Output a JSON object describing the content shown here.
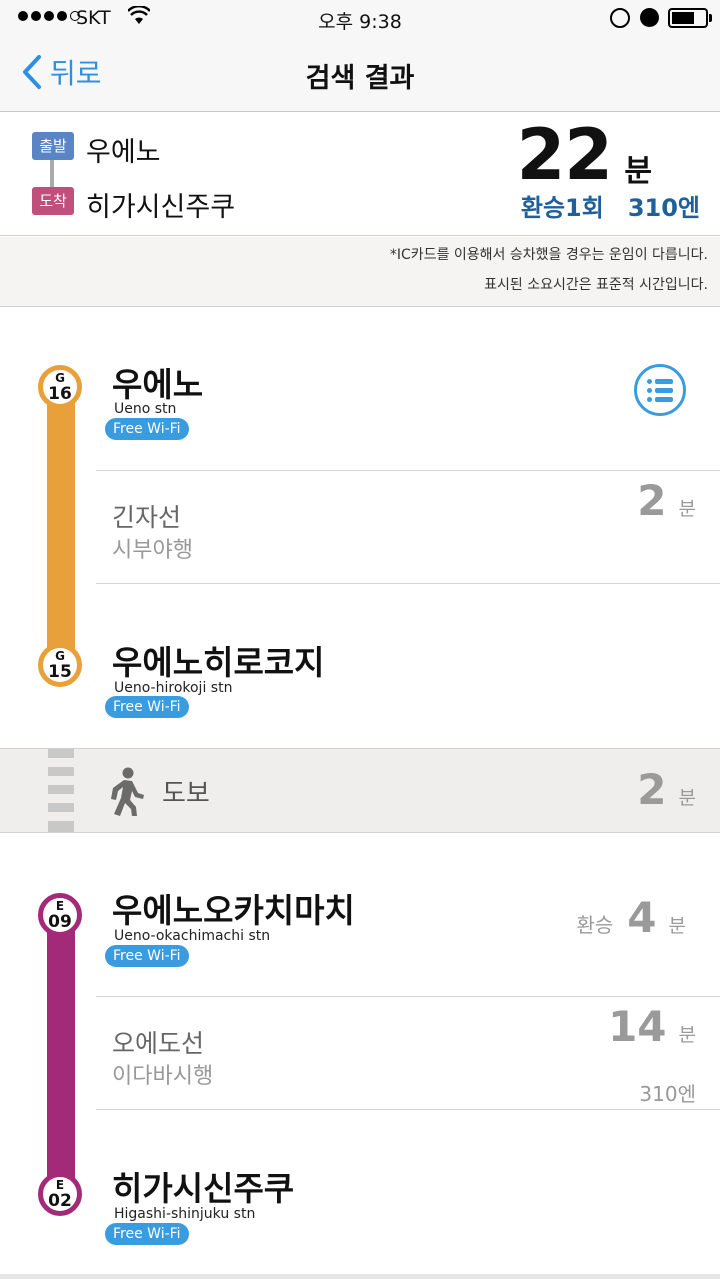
{
  "status_bar": {
    "carrier": "SKT",
    "time": "오후 9:38"
  },
  "nav": {
    "back_label": "뒤로",
    "title": "검색 결과"
  },
  "summary": {
    "departure_tag": "출발",
    "departure": "우에노",
    "arrival_tag": "도착",
    "arrival": "히가시신주쿠",
    "total_minutes": "22",
    "minutes_unit": "분",
    "transfers": "환승1회",
    "fare": "310엔"
  },
  "notes": [
    "*IC카드를 이용해서 승차했을 경우는 운임이 다릅니다.",
    "표시된 소요시간은 표준적 시간입니다."
  ],
  "segments": {
    "leg1": {
      "from": {
        "code_letter": "G",
        "code_no": "16",
        "name": "우에노",
        "name_en": "Ueno stn",
        "wifi": "Free Wi-Fi"
      },
      "line": {
        "name": "긴자선",
        "direction": "시부야행",
        "minutes": "2",
        "unit": "분"
      },
      "to": {
        "code_letter": "G",
        "code_no": "15",
        "name": "우에노히로코지",
        "name_en": "Ueno-hirokoji stn",
        "wifi": "Free Wi-Fi"
      },
      "color": "#e8a03a"
    },
    "walk": {
      "label": "도보",
      "minutes": "2",
      "unit": "분"
    },
    "leg2": {
      "from": {
        "code_letter": "E",
        "code_no": "09",
        "name": "우에노오카치마치",
        "name_en": "Ueno-okachimachi stn",
        "wifi": "Free Wi-Fi",
        "transfer_label": "환승",
        "transfer_minutes": "4",
        "unit": "분"
      },
      "line": {
        "name": "오에도선",
        "direction": "이다바시행",
        "minutes": "14",
        "unit": "분",
        "fare": "310엔"
      },
      "to": {
        "code_letter": "E",
        "code_no": "02",
        "name": "히가시신주쿠",
        "name_en": "Higashi-shinjuku stn",
        "wifi": "Free Wi-Fi"
      },
      "color": "#a32a78"
    }
  },
  "icons": {
    "back": "chevron-left-icon",
    "timetable": "list-icon",
    "walk": "walking-person-icon",
    "wifi": "wifi-icon",
    "rotation_lock": "rotation-lock-icon",
    "alarm": "alarm-icon",
    "battery": "battery-icon"
  },
  "colors": {
    "accent": "#2f8fe0",
    "ginza_line": "#e8a03a",
    "oedo_line": "#a32a78",
    "departure_tag": "#5b84c4",
    "arrival_tag": "#c04f7c",
    "wifi_badge": "#3a9ce0"
  }
}
